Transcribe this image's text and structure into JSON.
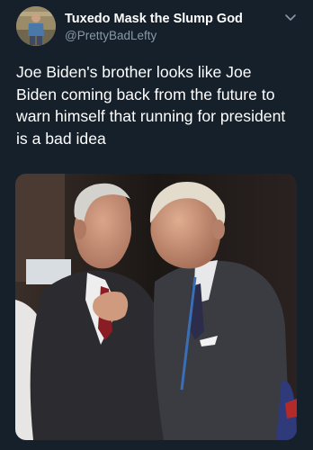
{
  "author": {
    "display_name": "Tuxedo Mask the Slump God",
    "handle": "@PrettyBadLefty",
    "avatar_icon": "profile-photo"
  },
  "menu_icon": "chevron-down-icon",
  "tweet": {
    "text_lines": [
      "Joe Biden's brother looks like Joe",
      "Biden coming back from the future to",
      "warn himself that running for president",
      "is a bad idea"
    ]
  },
  "media": {
    "type": "photo"
  },
  "colors": {
    "background": "#15202b",
    "secondary_text": "#8899a6",
    "primary_text": "#ffffff"
  }
}
